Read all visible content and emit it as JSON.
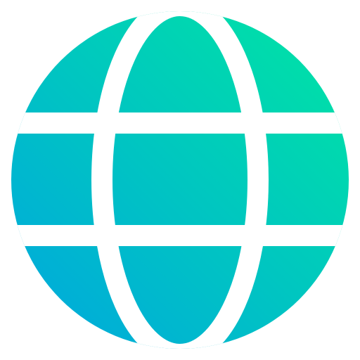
{
  "icon": {
    "name": "globe-icon",
    "colors": {
      "gradient_start": "#00a6df",
      "gradient_end": "#00e6a2",
      "line": "#ffffff",
      "background": "#ffffff"
    }
  }
}
